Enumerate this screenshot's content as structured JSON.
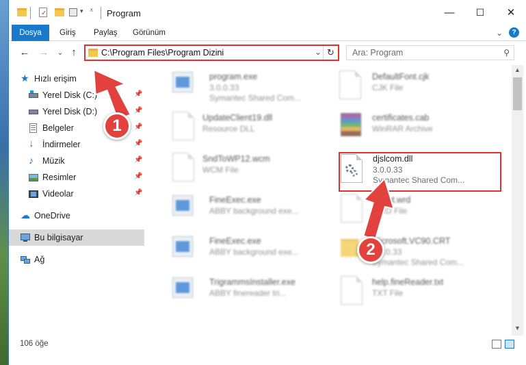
{
  "window": {
    "title": "Program",
    "minimize_glyph": "—",
    "maximize_glyph": "☐",
    "close_glyph": "✕"
  },
  "ribbon": {
    "tabs": [
      "Dosya",
      "Giriş",
      "Paylaş",
      "Görünüm"
    ],
    "help_glyph": "?",
    "expand_glyph": "⌄"
  },
  "nav": {
    "back": "←",
    "forward": "→",
    "recent": "⌄",
    "up": "↑",
    "address": "C:\\Program Files\\Program Dizini",
    "search_placeholder": "Ara: Program"
  },
  "sidebar": {
    "quick_access": "Hızlı erişim",
    "items": [
      {
        "label": "Yerel Disk (C:)",
        "icon": "drive-icon"
      },
      {
        "label": "Yerel Disk (D:)",
        "icon": "drive-icon"
      },
      {
        "label": "Belgeler",
        "icon": "documents-icon"
      },
      {
        "label": "İndirmeler",
        "icon": "downloads-icon"
      },
      {
        "label": "Müzik",
        "icon": "music-icon"
      },
      {
        "label": "Resimler",
        "icon": "pictures-icon"
      },
      {
        "label": "Videolar",
        "icon": "videos-icon"
      }
    ],
    "onedrive": "OneDrive",
    "this_pc": "Bu bilgisayar",
    "network": "Ağ"
  },
  "files": [
    {
      "name": "program.exe",
      "line1": "3.0.0.33",
      "line2": "Symantec Shared Com...",
      "icon": "exe"
    },
    {
      "name": "DefaultFont.cjk",
      "line1": "CJK File",
      "line2": "",
      "icon": "doc"
    },
    {
      "name": "UpdateClient19.dll",
      "line1": "Resource DLL",
      "line2": "",
      "icon": "doc"
    },
    {
      "name": "certificates.cab",
      "line1": "WinRAR Archive",
      "line2": "",
      "icon": "rar"
    },
    {
      "name": "SndToWP12.wcm",
      "line1": "WCM File",
      "line2": "",
      "icon": "doc"
    },
    {
      "name": "djslcom.dll",
      "line1": "3.0.0.33",
      "line2": "Symantec Shared Com...",
      "icon": "dll"
    },
    {
      "name": "FineExec.exe",
      "line1": "ABBY background exe...",
      "line2": "",
      "icon": "exe"
    },
    {
      "name": "About.wrd",
      "line1": "WRD File",
      "line2": "",
      "icon": "doc"
    },
    {
      "name": "FineExec.exe",
      "line1": "ABBY background exe...",
      "line2": "",
      "icon": "exe"
    },
    {
      "name": "Microsoft.VC90.CRT",
      "line1": "3.0.0.33",
      "line2": "Symantec Shared Com...",
      "icon": "folder"
    },
    {
      "name": "TrigrammsInstaller.exe",
      "line1": "ABBY finereader tri...",
      "line2": "",
      "icon": "exe"
    },
    {
      "name": "help.fineReader.txt",
      "line1": "TXT File",
      "line2": "",
      "icon": "doc"
    }
  ],
  "status": {
    "count": "106 öğe"
  },
  "annotations": {
    "step1": "1",
    "step2": "2"
  }
}
